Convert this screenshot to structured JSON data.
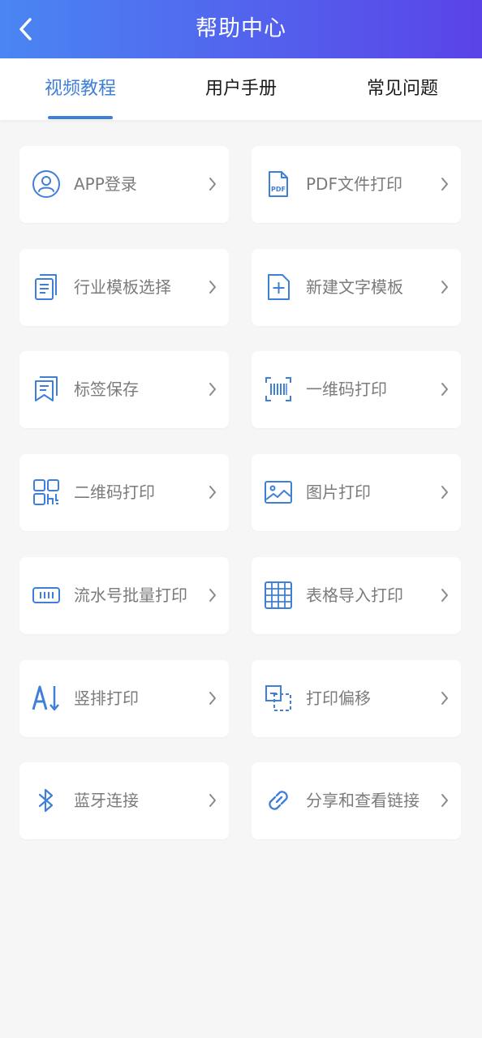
{
  "header": {
    "title": "帮助中心",
    "back_icon": "chevron-left-icon"
  },
  "tabs": [
    {
      "label": "视频教程",
      "active": true
    },
    {
      "label": "用户手册",
      "active": false
    },
    {
      "label": "常见问题",
      "active": false
    }
  ],
  "items": [
    {
      "label": "APP登录",
      "icon": "user-icon"
    },
    {
      "label": "PDF文件打印",
      "icon": "pdf-file-icon"
    },
    {
      "label": "行业模板选择",
      "icon": "document-icon"
    },
    {
      "label": "新建文字模板",
      "icon": "new-file-icon"
    },
    {
      "label": "标签保存",
      "icon": "bookmark-icon"
    },
    {
      "label": "一维码打印",
      "icon": "barcode-icon"
    },
    {
      "label": "二维码打印",
      "icon": "qrcode-icon"
    },
    {
      "label": "图片打印",
      "icon": "image-icon"
    },
    {
      "label": "流水号批量打印",
      "icon": "serial-number-icon"
    },
    {
      "label": "表格导入打印",
      "icon": "table-grid-icon"
    },
    {
      "label": "竖排打印",
      "icon": "vertical-text-icon"
    },
    {
      "label": "打印偏移",
      "icon": "offset-icon"
    },
    {
      "label": "蓝牙连接",
      "icon": "bluetooth-icon"
    },
    {
      "label": "分享和查看链接",
      "icon": "link-icon"
    }
  ],
  "colors": {
    "header_gradient_start": "#4a86f3",
    "header_gradient_end": "#5a43e8",
    "accent": "#3f7fd8",
    "icon": "#3f7fd8",
    "label": "#7b7b7b",
    "background": "#f6f6f6"
  }
}
